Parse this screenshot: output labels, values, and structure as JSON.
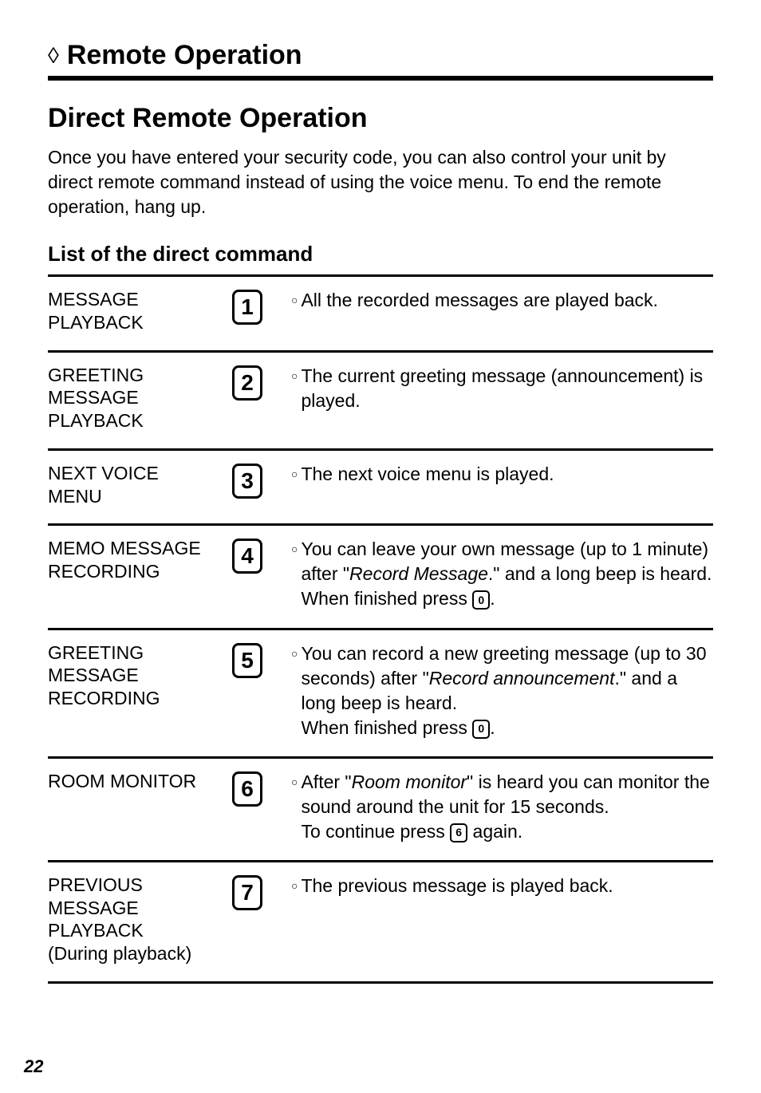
{
  "header": {
    "section_title": "Remote Operation"
  },
  "subsection": {
    "title": "Direct Remote Operation",
    "intro": "Once you have entered your security code, you can also control your unit by direct remote command instead of using the voice menu. To end the remote operation, hang up."
  },
  "list_title": "List of the direct command",
  "commands": [
    {
      "label": "MESSAGE PLAYBACK",
      "key": "1",
      "desc_pre": "All the recorded messages are played back.",
      "desc_em1": "",
      "desc_mid": "",
      "desc_em2": "",
      "desc_post": "",
      "inline_key": "",
      "desc_tail": ""
    },
    {
      "label": "GREETING MESSAGE PLAYBACK",
      "key": "2",
      "desc_pre": "The current greeting message (announcement) is played.",
      "desc_em1": "",
      "desc_mid": "",
      "desc_em2": "",
      "desc_post": "",
      "inline_key": "",
      "desc_tail": ""
    },
    {
      "label": "NEXT VOICE MENU",
      "key": "3",
      "desc_pre": "The next voice menu is played.",
      "desc_em1": "",
      "desc_mid": "",
      "desc_em2": "",
      "desc_post": "",
      "inline_key": "",
      "desc_tail": ""
    },
    {
      "label": "MEMO MESSAGE RECORDING",
      "key": "4",
      "desc_pre": "You can leave your own message (up to 1 minute) after \"",
      "desc_em1": "Record Message",
      "desc_mid": ".\" and a long beep is heard.",
      "desc_em2": "",
      "desc_post": " When finished press ",
      "inline_key": "0",
      "desc_tail": "."
    },
    {
      "label": "GREETING MESSAGE RECORDING",
      "key": "5",
      "desc_pre": "You can record a new greeting message (up to 30 seconds) after \"",
      "desc_em1": "Record announcement",
      "desc_mid": ".\" and a long beep is heard.",
      "desc_em2": "",
      "desc_post": " When finished press ",
      "inline_key": "0",
      "desc_tail": "."
    },
    {
      "label": "ROOM MONITOR",
      "key": "6",
      "desc_pre": "After \"",
      "desc_em1": "Room monitor",
      "desc_mid": "\" is heard you can monitor the sound around the unit for 15 seconds.",
      "desc_em2": "",
      "desc_post": " To continue press ",
      "inline_key": "6",
      "desc_tail": " again."
    },
    {
      "label": "PREVIOUS MESSAGE PLAYBACK (During playback)",
      "key": "7",
      "desc_pre": "The previous message is played back.",
      "desc_em1": "",
      "desc_mid": "",
      "desc_em2": "",
      "desc_post": "",
      "inline_key": "",
      "desc_tail": ""
    }
  ],
  "page_number": "22"
}
